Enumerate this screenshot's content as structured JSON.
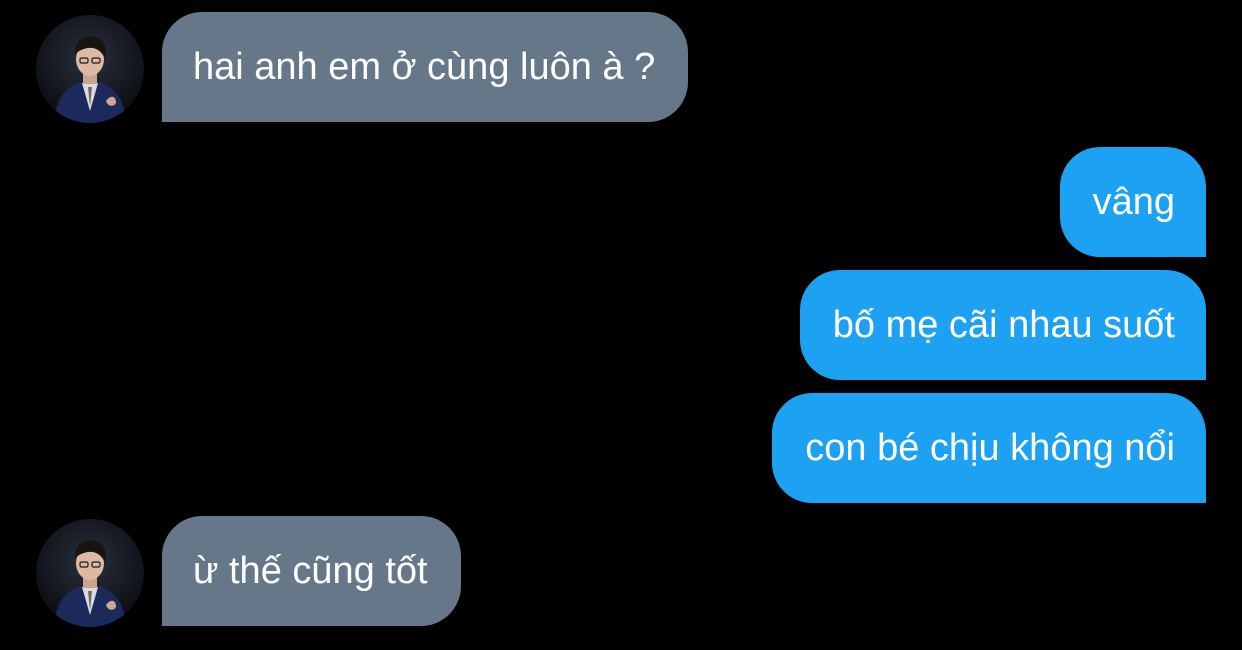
{
  "conversation": {
    "messages": [
      {
        "sender": "other",
        "text": "hai anh em ở cùng luôn à ?",
        "avatar_icon": "person-in-suit-avatar"
      },
      {
        "sender": "me",
        "text": "vâng"
      },
      {
        "sender": "me",
        "text": "bố mẹ cãi nhau suốt"
      },
      {
        "sender": "me",
        "text": "con bé chịu không nổi"
      },
      {
        "sender": "other",
        "text": "ừ thế cũng tốt",
        "avatar_icon": "person-in-suit-avatar"
      }
    ]
  },
  "colors": {
    "background": "#000000",
    "incoming_bubble": "#66778a",
    "outgoing_bubble": "#1da1f2",
    "text": "#ffffff"
  }
}
